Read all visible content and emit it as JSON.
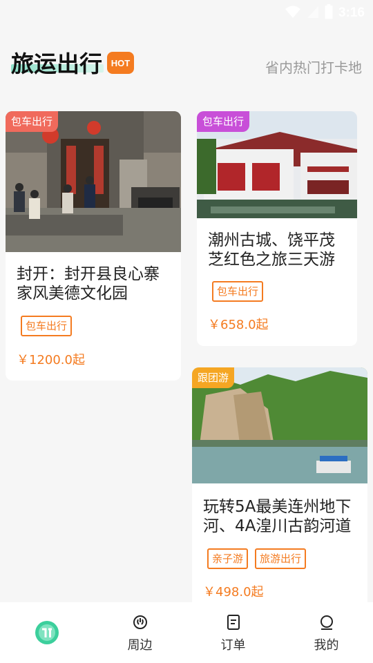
{
  "status_bar": {
    "time": "3:16"
  },
  "header": {
    "title": "旅运出行",
    "badge": "HOT",
    "subtitle": "省内热门打卡地"
  },
  "cards": [
    {
      "type_tag": "包车出行",
      "type_color": "#f06a5c",
      "title": "封开：封开县良心寨家风美德文化园",
      "tags": [
        "包车出行"
      ],
      "price": "￥1200.0起"
    },
    {
      "type_tag": "包车出行",
      "type_color": "#c84fd8",
      "title": "潮州古城、饶平茂芝红色之旅三天游",
      "tags": [
        "包车出行"
      ],
      "price": "￥658.0起"
    },
    {
      "type_tag": "跟团游",
      "type_color": "#f5a623",
      "title": "玩转5A最美连州地下河、4A湟川古韵河道",
      "tags": [
        "亲子游",
        "旅游出行"
      ],
      "price": "￥498.0起"
    }
  ],
  "tabbar": {
    "items": [
      {
        "label": "",
        "icon": "home-logo-icon"
      },
      {
        "label": "周边",
        "icon": "nearby-icon"
      },
      {
        "label": "订单",
        "icon": "order-icon"
      },
      {
        "label": "我的",
        "icon": "profile-icon"
      }
    ]
  },
  "colors": {
    "accent": "#f47b20",
    "brand_green": "#3ccf9c"
  }
}
